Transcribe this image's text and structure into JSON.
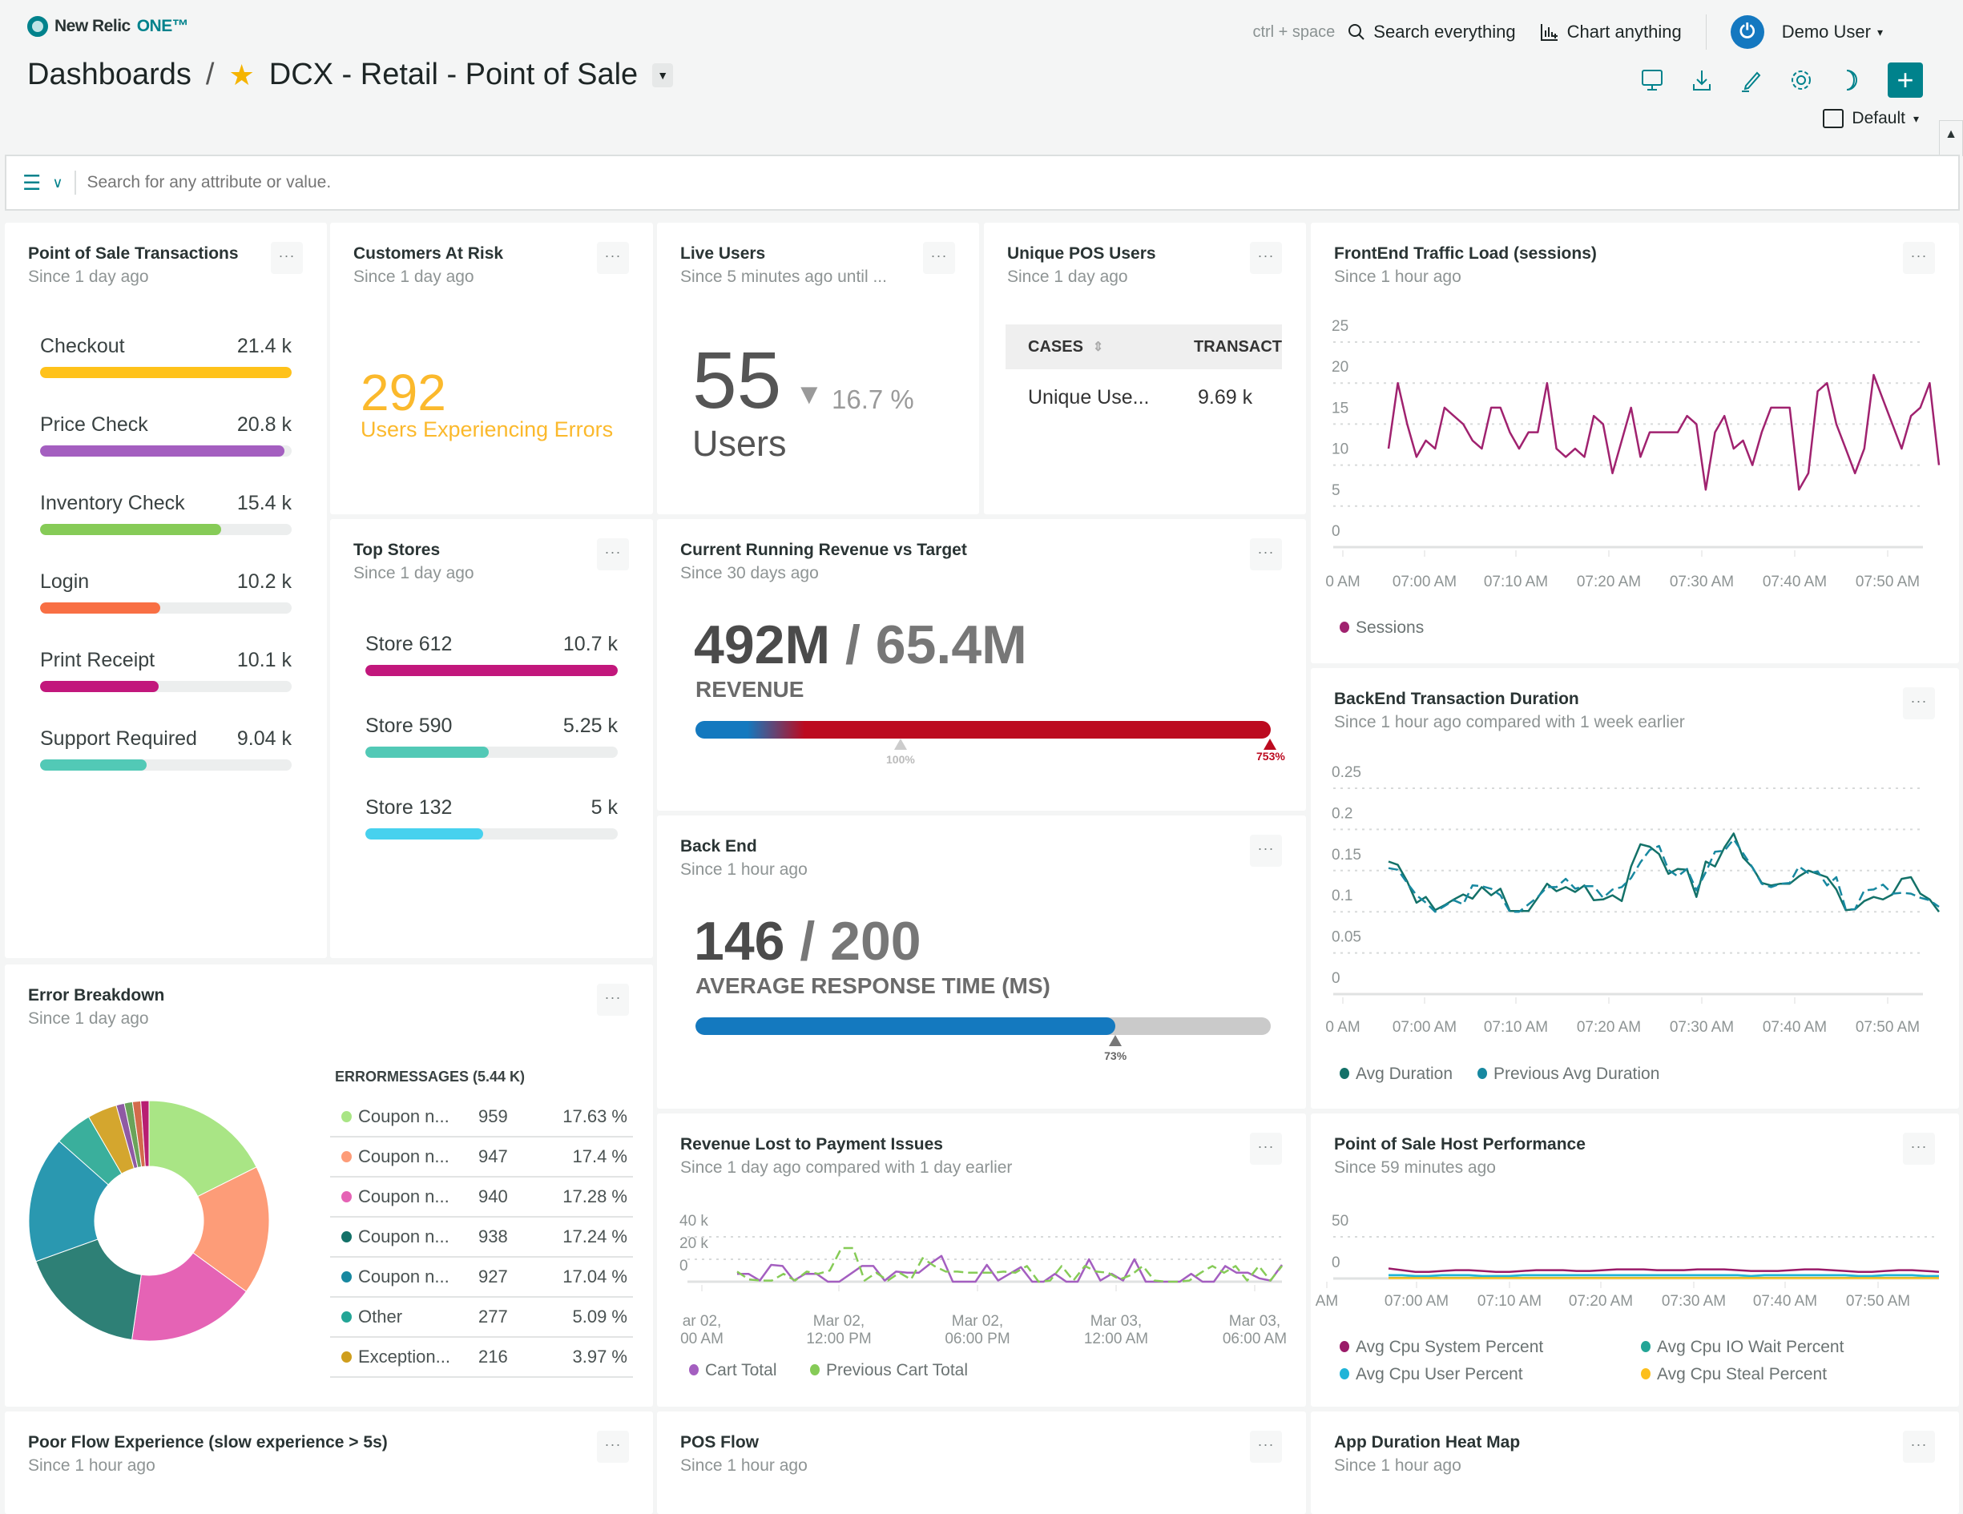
{
  "app": {
    "brand": "New Relic",
    "brand_suffix": "ONE™"
  },
  "header": {
    "breadcrumb_root": "Dashboards",
    "separator": "/",
    "dashboard_title": "DCX - Retail - Point of Sale",
    "shortcut_hint": "ctrl + space",
    "search_label": "Search everything",
    "chart_label": "Chart anything",
    "user_name": "Demo User",
    "time_picker": "Default"
  },
  "filter": {
    "placeholder": "Search for any attribute or value."
  },
  "widgets": {
    "pos_transactions": {
      "title": "Point of Sale Transactions",
      "subtitle": "Since 1 day ago",
      "items": [
        {
          "label": "Checkout",
          "value": "21.4 k",
          "fraction": 1.0,
          "color": "#ffc21a"
        },
        {
          "label": "Price Check",
          "value": "20.8 k",
          "fraction": 0.972,
          "color": "#a45fc0"
        },
        {
          "label": "Inventory Check",
          "value": "15.4 k",
          "fraction": 0.72,
          "color": "#86cb57"
        },
        {
          "label": "Login",
          "value": "10.2 k",
          "fraction": 0.477,
          "color": "#f86f44"
        },
        {
          "label": "Print Receipt",
          "value": "10.1 k",
          "fraction": 0.472,
          "color": "#c2177c"
        },
        {
          "label": "Support Required",
          "value": "9.04 k",
          "fraction": 0.422,
          "color": "#52c9b6"
        }
      ]
    },
    "customers_at_risk": {
      "title": "Customers At Risk",
      "subtitle": "Since 1 day ago",
      "value": "292",
      "label": "Users Experiencing Errors",
      "color": "#fbb92c"
    },
    "live_users": {
      "title": "Live Users",
      "subtitle": "Since 5 minutes ago until ...",
      "value": "55",
      "change": "16.7 %",
      "change_direction": "down",
      "unit": "Users"
    },
    "unique_pos_users": {
      "title": "Unique POS Users",
      "subtitle": "Since 1 day ago",
      "columns": [
        "CASES",
        "TRANSACT"
      ],
      "rows": [
        [
          "Unique Use...",
          "9.69 k"
        ]
      ]
    },
    "frontend_traffic": {
      "title": "FrontEnd Traffic Load (sessions)",
      "subtitle": "Since 1 hour ago"
    },
    "top_stores": {
      "title": "Top Stores",
      "subtitle": "Since 1 day ago",
      "items": [
        {
          "label": "Store 612",
          "value": "10.7 k",
          "fraction": 1.0,
          "color": "#c2177c"
        },
        {
          "label": "Store 590",
          "value": "5.25 k",
          "fraction": 0.49,
          "color": "#52c9b6"
        },
        {
          "label": "Store 132",
          "value": "5 k",
          "fraction": 0.467,
          "color": "#47d1ee"
        }
      ]
    },
    "revenue_vs_target": {
      "title": "Current Running Revenue vs Target",
      "subtitle": "Since 30 days ago",
      "value": "492M",
      "target": "65.4M",
      "label": "REVENUE",
      "target_marker": "100%",
      "percent_label": "753%",
      "percent": 753
    },
    "backend_transaction_duration": {
      "title": "BackEnd Transaction Duration",
      "subtitle": "Since 1 hour ago compared with 1 week earlier"
    },
    "back_end": {
      "title": "Back End",
      "subtitle": "Since 1 hour ago",
      "value": "146",
      "target": "200",
      "label": "AVERAGE RESPONSE TIME (MS)",
      "percent_label": "73%",
      "percent": 73
    },
    "error_breakdown": {
      "title": "Error Breakdown",
      "subtitle": "Since 1 day ago",
      "table_header": "ERRORMESSAGES (5.44 K)",
      "rows": [
        {
          "label": "Coupon n...",
          "count": "959",
          "pct": "17.63 %",
          "color": "#a9e585"
        },
        {
          "label": "Coupon n...",
          "count": "947",
          "pct": "17.4 %",
          "color": "#fd9c78"
        },
        {
          "label": "Coupon n...",
          "count": "940",
          "pct": "17.28 %",
          "color": "#e563b5"
        },
        {
          "label": "Coupon n...",
          "count": "938",
          "pct": "17.24 %",
          "color": "#137168"
        },
        {
          "label": "Coupon n...",
          "count": "927",
          "pct": "17.04 %",
          "color": "#1788a0"
        },
        {
          "label": "Other",
          "count": "277",
          "pct": "5.09 %",
          "color": "#23a596"
        },
        {
          "label": "Exception...",
          "count": "216",
          "pct": "3.97 %",
          "color": "#cf9e1d"
        }
      ]
    },
    "revenue_lost": {
      "title": "Revenue Lost to Payment Issues",
      "subtitle": "Since 1 day ago compared with 1 day earlier"
    },
    "host_performance": {
      "title": "Point of Sale Host Performance",
      "subtitle": "Since 59 minutes ago"
    },
    "poor_flow": {
      "title": "Poor Flow Experience (slow experience > 5s)",
      "subtitle": "Since 1 hour ago"
    },
    "pos_flow": {
      "title": "POS Flow",
      "subtitle": "Since 1 hour ago"
    },
    "app_duration_heatmap": {
      "title": "App Duration Heat Map",
      "subtitle": "Since 1 hour ago"
    }
  },
  "chart_data": [
    {
      "id": "frontend_traffic",
      "type": "line",
      "title": "FrontEnd Traffic Load (sessions)",
      "xlabel": "",
      "ylabel": "",
      "ylim": [
        0,
        25
      ],
      "yticks": [
        0,
        5,
        10,
        15,
        20,
        25
      ],
      "xticks": [
        "0 AM",
        "07:00 AM",
        "07:10 AM",
        "07:20 AM",
        "07:30 AM",
        "07:40 AM",
        "07:50 AM"
      ],
      "x_start_min": -4,
      "x_step_min": 1,
      "grid": true,
      "legend": "bottom-left",
      "series": [
        {
          "name": "Sessions",
          "color": "#a0226f",
          "values": [
            12,
            20,
            15,
            11,
            13,
            12,
            17,
            16,
            15,
            13,
            12,
            17,
            17,
            14,
            12,
            14,
            14,
            20,
            12,
            11,
            12,
            11,
            16,
            15,
            9,
            13,
            17,
            11,
            14,
            14,
            14,
            14,
            16,
            15,
            7,
            14,
            16,
            12,
            13,
            10,
            14,
            17,
            17,
            17,
            7,
            9,
            19,
            20,
            15,
            12,
            9,
            12,
            21,
            18,
            15,
            12,
            16,
            17,
            20,
            10
          ]
        }
      ]
    },
    {
      "id": "backend_transaction_duration",
      "type": "line",
      "title": "BackEnd Transaction Duration",
      "ylim": [
        0,
        0.25
      ],
      "yticks": [
        0,
        0.05,
        0.1,
        0.15,
        0.2,
        0.25
      ],
      "xticks": [
        "0 AM",
        "07:00 AM",
        "07:10 AM",
        "07:20 AM",
        "07:30 AM",
        "07:40 AM",
        "07:50 AM"
      ],
      "x_start_min": -4,
      "x_step_min": 1,
      "grid": true,
      "legend": "bottom-left",
      "series": [
        {
          "name": "Avg Duration",
          "color": "#137168",
          "dash": false,
          "values": [
            0.161,
            0.157,
            0.137,
            0.111,
            0.118,
            0.102,
            0.108,
            0.115,
            0.121,
            0.116,
            0.13,
            0.12,
            0.128,
            0.101,
            0.101,
            0.101,
            0.117,
            0.134,
            0.125,
            0.13,
            0.124,
            0.132,
            0.114,
            0.115,
            0.12,
            0.113,
            0.155,
            0.182,
            0.179,
            0.17,
            0.146,
            0.152,
            0.151,
            0.118,
            0.161,
            0.155,
            0.178,
            0.195,
            0.166,
            0.154,
            0.135,
            0.132,
            0.134,
            0.134,
            0.143,
            0.15,
            0.146,
            0.142,
            0.127,
            0.102,
            0.103,
            0.113,
            0.118,
            0.115,
            0.121,
            0.14,
            0.142,
            0.122,
            0.115,
            0.1
          ]
        },
        {
          "name": "Previous Avg Duration",
          "color": "#1788a0",
          "dash": true,
          "values": [
            0.153,
            0.151,
            0.135,
            0.12,
            0.111,
            0.1,
            0.107,
            0.114,
            0.109,
            0.132,
            0.131,
            0.128,
            0.12,
            0.1,
            0.1,
            0.109,
            0.118,
            0.13,
            0.13,
            0.14,
            0.128,
            0.131,
            0.131,
            0.117,
            0.127,
            0.13,
            0.141,
            0.16,
            0.175,
            0.18,
            0.151,
            0.143,
            0.152,
            0.126,
            0.148,
            0.173,
            0.174,
            0.188,
            0.171,
            0.154,
            0.134,
            0.13,
            0.134,
            0.135,
            0.155,
            0.147,
            0.149,
            0.132,
            0.142,
            0.103,
            0.103,
            0.126,
            0.127,
            0.133,
            0.122,
            0.123,
            0.122,
            0.117,
            0.114,
            0.106
          ]
        }
      ]
    },
    {
      "id": "revenue_lost",
      "type": "line",
      "title": "Revenue Lost to Payment Issues",
      "ylim": [
        0,
        40000
      ],
      "yticks": [
        "0",
        "20 k",
        "40 k"
      ],
      "xticks": [
        "ar 02,\n00 AM",
        "Mar 02,\n12:00 PM",
        "Mar 02,\n06:00 PM",
        "Mar 03,\n12:00 AM",
        "Mar 03,\n06:00 AM"
      ],
      "grid": true,
      "legend": "bottom-left",
      "series": [
        {
          "name": "Cart Total",
          "color": "#a45fc0",
          "dash": false,
          "values": [
            7000,
            7000,
            1000,
            15000,
            14000,
            1000,
            7000,
            7000,
            0,
            0,
            7000,
            14000,
            14000,
            1000,
            9000,
            8000,
            8000,
            16000,
            23000,
            0,
            0,
            0,
            15000,
            1000,
            7000,
            13000,
            0,
            0,
            7000,
            0,
            0,
            20000,
            1000,
            7000,
            1000,
            20000,
            0,
            0,
            0,
            0,
            7000,
            0,
            0,
            14000,
            8000,
            8000,
            3000,
            1000,
            15000
          ]
        },
        {
          "name": "Previous Cart Total",
          "color": "#86cb57",
          "dash": true,
          "values": [
            9000,
            2000,
            1000,
            1000,
            7000,
            1000,
            9000,
            7000,
            10000,
            30000,
            30000,
            1000,
            8000,
            1000,
            8000,
            2000,
            21000,
            14000,
            9000,
            9000,
            8000,
            8000,
            8000,
            9000,
            8000,
            14000,
            0,
            1000,
            14000,
            1000,
            14000,
            9000,
            8000,
            2000,
            6000,
            14000,
            1000,
            0,
            0,
            1000,
            8000,
            14000,
            8000,
            14000,
            1000,
            14000,
            1000,
            14000
          ]
        }
      ]
    },
    {
      "id": "host_performance",
      "type": "line",
      "title": "Point of Sale Host Performance",
      "ylim": [
        0,
        50
      ],
      "yticks": [
        0,
        50
      ],
      "xticks": [
        "AM",
        "07:00 AM",
        "07:10 AM",
        "07:20 AM",
        "07:30 AM",
        "07:40 AM",
        "07:50 AM"
      ],
      "grid": true,
      "legend": "bottom-left",
      "series": [
        {
          "name": "Avg Cpu System Percent",
          "color": "#9a1a68",
          "values": [
            12,
            10,
            8,
            8,
            9,
            10,
            10,
            9,
            8,
            8,
            9,
            10,
            10,
            10,
            9,
            9,
            10,
            11,
            11,
            11,
            10,
            10,
            10,
            11,
            11,
            11,
            10,
            9,
            9,
            9,
            10,
            11,
            11,
            10,
            9,
            8,
            8,
            9,
            10,
            10,
            9,
            8
          ]
        },
        {
          "name": "Avg Cpu IO Wait Percent",
          "color": "#23a596",
          "values": [
            1,
            1,
            1,
            1,
            1,
            1,
            1,
            1,
            1,
            1,
            1,
            1,
            1,
            1,
            1,
            1,
            1,
            1,
            1,
            1,
            1,
            1,
            1,
            1,
            1,
            1,
            1,
            1,
            1,
            1,
            1,
            1,
            1,
            1,
            1,
            1,
            1,
            1,
            1,
            1,
            1,
            1
          ]
        },
        {
          "name": "Avg Cpu User Percent",
          "color": "#1fb4d8",
          "values": [
            4,
            4,
            3,
            3,
            4,
            4,
            4,
            3,
            3,
            3,
            4,
            4,
            4,
            4,
            4,
            4,
            4,
            4,
            4,
            4,
            4,
            4,
            4,
            4,
            4,
            4,
            4,
            3,
            4,
            4,
            4,
            4,
            4,
            4,
            4,
            3,
            3,
            4,
            4,
            4,
            3,
            3
          ]
        },
        {
          "name": "Avg Cpu Steal Percent",
          "color": "#fcbf1d",
          "values": [
            0.5,
            0.5,
            0.5,
            0.5,
            0.5,
            0.5,
            0.5,
            0.5,
            0.5,
            0.5,
            0.5,
            0.5,
            0.5,
            0.5,
            0.5,
            0.5,
            0.5,
            0.5,
            0.5,
            0.5,
            0.5,
            0.5,
            0.5,
            0.5,
            0.5,
            0.5,
            0.5,
            0.5,
            0.5,
            0.5,
            0.5,
            0.5,
            0.5,
            0.5,
            0.5,
            0.5,
            0.5,
            0.5,
            0.5,
            0.5,
            0.5,
            0.5
          ]
        }
      ]
    },
    {
      "id": "error_breakdown",
      "type": "pie",
      "title": "Error Breakdown",
      "donut": true,
      "slices": [
        {
          "label": "Coupon n...",
          "value": 959,
          "color": "#a9e585"
        },
        {
          "label": "Coupon n...",
          "value": 947,
          "color": "#fd9c78"
        },
        {
          "label": "Coupon n...",
          "value": 940,
          "color": "#e563b5"
        },
        {
          "label": "Coupon n...",
          "value": 938,
          "color": "#2e8076"
        },
        {
          "label": "Coupon n...",
          "value": 927,
          "color": "#2a98b0"
        },
        {
          "label": "Other",
          "value": 277,
          "color": "#3aaf9c"
        },
        {
          "label": "Exception...",
          "value": 216,
          "color": "#d4a62e"
        },
        {
          "label": "",
          "value": 60,
          "color": "#8f5aa4"
        },
        {
          "label": "",
          "value": 60,
          "color": "#6aa35a"
        },
        {
          "label": "",
          "value": 60,
          "color": "#d36b4c"
        },
        {
          "label": "",
          "value": 60,
          "color": "#b81f72"
        }
      ]
    }
  ]
}
